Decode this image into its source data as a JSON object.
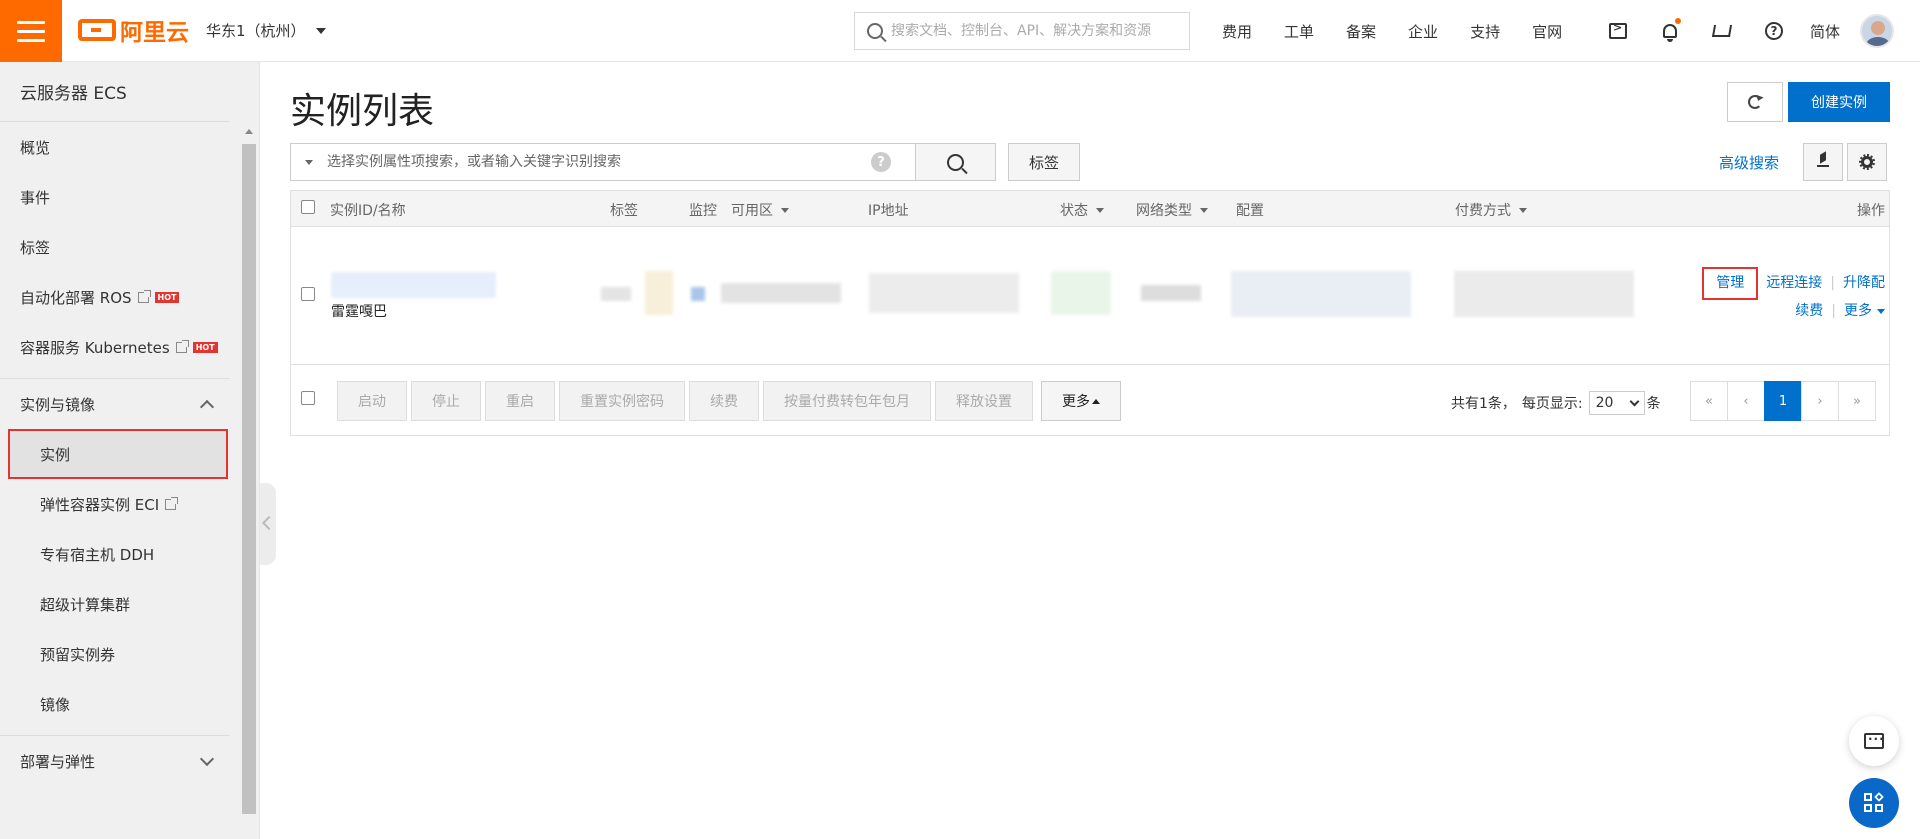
{
  "header": {
    "logo_text": "阿里云",
    "region": "华东1（杭州）",
    "search_placeholder": "搜索文档、控制台、API、解决方案和资源",
    "nav": [
      "费用",
      "工单",
      "备案",
      "企业",
      "支持",
      "官网"
    ],
    "lang": "简体",
    "icons": [
      "terminal-icon",
      "bell-icon",
      "cart-icon",
      "help-icon"
    ]
  },
  "sidebar": {
    "title": "云服务器 ECS",
    "items": [
      {
        "label": "概览"
      },
      {
        "label": "事件"
      },
      {
        "label": "标签"
      },
      {
        "label": "自动化部署 ROS",
        "badge": "HOT"
      },
      {
        "label": "容器服务 Kubernetes",
        "badge": "HOT"
      }
    ],
    "group1": {
      "label": "实例与镜像",
      "items": [
        "实例",
        "弹性容器实例 ECI",
        "专有宿主机 DDH",
        "超级计算集群",
        "预留实例券",
        "镜像"
      ]
    },
    "group2": {
      "label": "部署与弹性"
    }
  },
  "main": {
    "title": "实例列表",
    "create_label": "创建实例",
    "filter_placeholder": "选择实例属性项搜索，或者输入关键字识别搜索",
    "tag_label": "标签",
    "adv_search_label": "高级搜索",
    "table": {
      "headers": {
        "id": "实例ID/名称",
        "tag": "标签",
        "monitor": "监控",
        "zone": "可用区",
        "ip": "IP地址",
        "status": "状态",
        "network": "网络类型",
        "config": "配置",
        "billing": "付费方式",
        "ops": "操作"
      },
      "rows": [
        {
          "name": "雷霆嘎巴",
          "actions": {
            "manage": "管理",
            "remote": "远程连接",
            "upgrade": "升降配",
            "renew": "续费",
            "more": "更多"
          }
        }
      ]
    },
    "bulk_actions": [
      "启动",
      "停止",
      "重启",
      "重置实例密码",
      "续费",
      "按量付费转包年包月",
      "释放设置"
    ],
    "bulk_more": "更多",
    "pagination": {
      "total_text": "共有1条，",
      "per_page_label": "每页显示:",
      "per_page_value": "20",
      "unit": "条",
      "first": "«",
      "prev": "‹",
      "current": "1",
      "next": "›",
      "last": "»"
    }
  },
  "colors": {
    "brand": "#ff6a00",
    "primary": "#0070cc",
    "highlight": "#e3342f"
  }
}
